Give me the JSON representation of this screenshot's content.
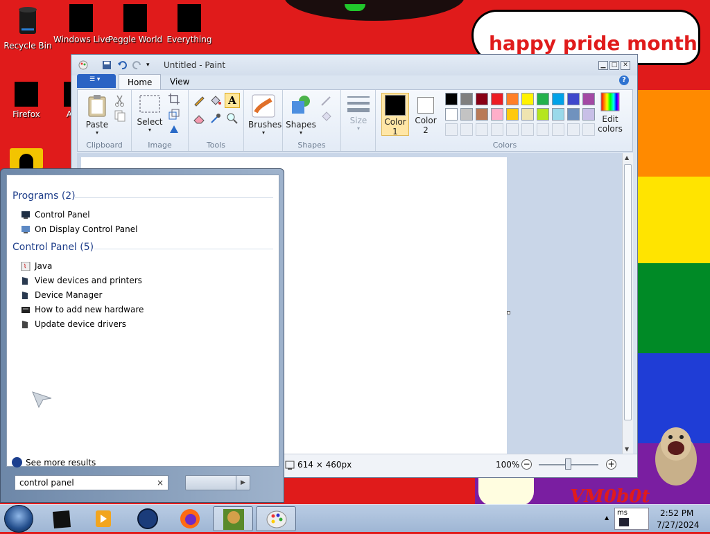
{
  "desktop": {
    "banner": "happy pride month",
    "watermark": "VM0b0t",
    "icons": [
      {
        "label": "Recycle Bin"
      },
      {
        "label": "Windows Live"
      },
      {
        "label": "Peggle World"
      },
      {
        "label": "Everything"
      },
      {
        "label": "Firefox"
      },
      {
        "label": "A"
      }
    ]
  },
  "paint": {
    "title": "Untitled - Paint",
    "tabs": {
      "home": "Home",
      "view": "View"
    },
    "help": "?",
    "groups": {
      "clipboard": "Clipboard",
      "image": "Image",
      "tools": "Tools",
      "shapes": "Shapes",
      "colors": "Colors"
    },
    "buttons": {
      "paste": "Paste",
      "select": "Select",
      "brushes": "Brushes",
      "shapes": "Shapes",
      "size": "Size",
      "color1": "Color",
      "color1_num": "1",
      "color2": "Color",
      "color2_num": "2",
      "edit_colors": "Edit",
      "edit_colors2": "colors",
      "text_tool": "A"
    },
    "palette_row1": [
      "#000000",
      "#7f7f7f",
      "#880015",
      "#ed1c24",
      "#ff7f27",
      "#fff200",
      "#22b14c",
      "#00a2e8",
      "#3f48cc",
      "#a349a4"
    ],
    "palette_row2": [
      "#ffffff",
      "#c3c3c3",
      "#b97a57",
      "#ffaec9",
      "#ffc90e",
      "#efe4b0",
      "#b5e61d",
      "#99d9ea",
      "#7092be",
      "#c8bfe7"
    ],
    "status": {
      "size": "614 × 460px",
      "zoom": "100%",
      "zoom_level": 0.5
    }
  },
  "start_search": {
    "sections": [
      {
        "heading": "Programs (2)",
        "items": [
          "Control Panel",
          "On Display Control Panel"
        ]
      },
      {
        "heading": "Control Panel (5)",
        "items": [
          "Java",
          "View devices and printers",
          "Device Manager",
          "How to add new hardware",
          "Update device drivers"
        ]
      }
    ],
    "see_more": "See more results",
    "query": "control panel",
    "clear": "×",
    "shutdown_arrow": "▶"
  },
  "taskbar": {
    "time": "2:52 PM",
    "date": "7/27/2024",
    "tray_text": "ms"
  }
}
